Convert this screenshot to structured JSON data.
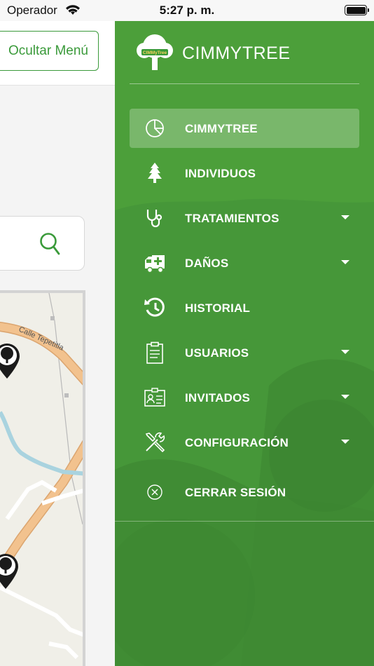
{
  "status_bar": {
    "carrier": "Operador",
    "time": "5:27 p. m."
  },
  "left_pane": {
    "hide_menu_label": "Ocultar Menú",
    "map": {
      "street_label": "Calle Tepetitla"
    }
  },
  "side_menu": {
    "brand": {
      "title": "CIMMYTREE",
      "logo_text": "CIMMyTree"
    },
    "items": [
      {
        "label": "CIMMYTREE",
        "icon": "pie-chart-icon",
        "active": true,
        "has_submenu": false
      },
      {
        "label": "INDIVIDUOS",
        "icon": "tree-icon",
        "active": false,
        "has_submenu": false
      },
      {
        "label": "TRATAMIENTOS",
        "icon": "stethoscope-icon",
        "active": false,
        "has_submenu": true
      },
      {
        "label": "DAÑOS",
        "icon": "ambulance-icon",
        "active": false,
        "has_submenu": true
      },
      {
        "label": "HISTORIAL",
        "icon": "history-icon",
        "active": false,
        "has_submenu": false
      },
      {
        "label": "USUARIOS",
        "icon": "clipboard-icon",
        "active": false,
        "has_submenu": true
      },
      {
        "label": "INVITADOS",
        "icon": "id-card-icon",
        "active": false,
        "has_submenu": true
      },
      {
        "label": "CONFIGURACIÓN",
        "icon": "tools-icon",
        "active": false,
        "has_submenu": true
      },
      {
        "label": "CERRAR SESIÓN",
        "icon": "close-circle-icon",
        "active": false,
        "has_submenu": false
      }
    ]
  },
  "colors": {
    "menu_green": "#4c9f3a",
    "accent_green": "#3a9a3a",
    "map_road": "#f2c28e",
    "map_river": "#a9d3df"
  }
}
